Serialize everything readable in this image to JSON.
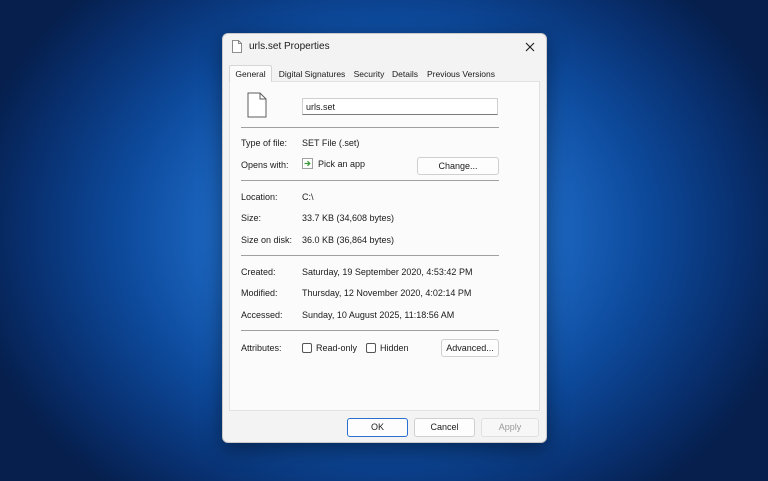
{
  "window": {
    "title": "urls.set Properties",
    "close_icon": "close-icon"
  },
  "tabs": [
    {
      "label": "General",
      "active": true
    },
    {
      "label": "Digital Signatures",
      "active": false
    },
    {
      "label": "Security",
      "active": false
    },
    {
      "label": "Details",
      "active": false
    },
    {
      "label": "Previous Versions",
      "active": false
    }
  ],
  "general": {
    "file_name": "urls.set",
    "type_label": "Type of file:",
    "type_value": "SET File (.set)",
    "opens_label": "Opens with:",
    "opens_value": "Pick an app",
    "change_button": "Change...",
    "location_label": "Location:",
    "location_value": "C:\\",
    "size_label": "Size:",
    "size_value": "33.7 KB (34,608 bytes)",
    "size_on_disk_label": "Size on disk:",
    "size_on_disk_value": "36.0 KB (36,864 bytes)",
    "created_label": "Created:",
    "created_value": "Saturday, 19 September 2020, 4:53:42 PM",
    "modified_label": "Modified:",
    "modified_value": "Thursday, 12 November 2020, 4:02:14 PM",
    "accessed_label": "Accessed:",
    "accessed_value": "Sunday, 10 August 2025, 11:18:56 AM",
    "attributes_label": "Attributes:",
    "readonly_label": "Read-only",
    "readonly_checked": false,
    "hidden_label": "Hidden",
    "hidden_checked": false,
    "advanced_button": "Advanced..."
  },
  "footer": {
    "ok": "OK",
    "cancel": "Cancel",
    "apply": "Apply"
  },
  "colors": {
    "accent": "#2a6fd0",
    "background_blue": "#1f6cc8"
  }
}
